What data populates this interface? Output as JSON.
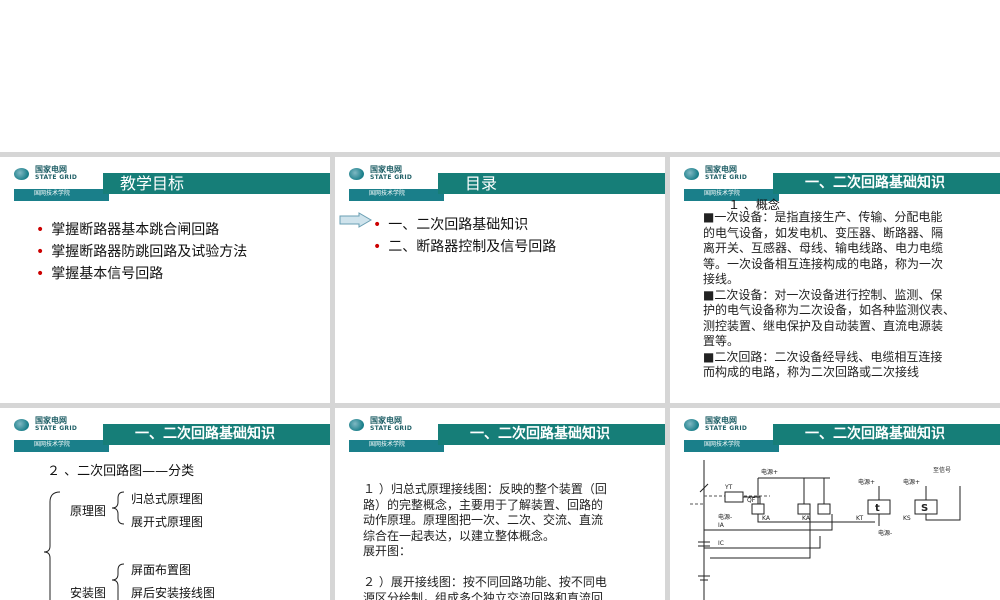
{
  "logo": {
    "cn": "国家电网",
    "en": "STATE GRID",
    "sub": "国网技术学院"
  },
  "slides": {
    "s1": {
      "title": "教学目标",
      "items": [
        "掌握断路器基本跳合闸回路",
        "掌握断路器防跳回路及试验方法",
        "掌握基本信号回路"
      ]
    },
    "s2": {
      "title": "目录",
      "items": [
        "一、二次回路基础知识",
        "二、断路器控制及信号回路"
      ]
    },
    "s3": {
      "title": "一、二次回路基础知识",
      "heading": "１ 、概念",
      "lines": [
        "■一次设备：是指直接生产、传输、分配电能",
        "的电气设备，如发电机、变压器、断路器、隔",
        "离开关、互感器、母线、输电线路、电力电缆",
        "等。一次设备相互连接构成的电路，称为一次",
        "接线。",
        "■二次设备：对一次设备进行控制、监测、保",
        "护的电气设备称为二次设备，如各种监测仪表、",
        "测控装置、继电保护及自动装置、直流电源装",
        "置等。",
        "■二次回路：二次设备经导线、电缆相互连接",
        "而构成的电路，称为二次回路或二次接线"
      ]
    },
    "s4": {
      "title": "一、二次回路基础知识",
      "heading": "２ 、二次回路图——分类",
      "group1": "原理图",
      "group1_items": [
        "归总式原理图",
        "展开式原理图"
      ],
      "group2": "安装图",
      "group2_items": [
        "屏面布置图",
        "屏后安装接线图"
      ]
    },
    "s5": {
      "title": "一、二次回路基础知识",
      "para1": [
        "１ ）归总式原理接线图：反映的整个装置（回",
        "路）的完整概念，主要用于了解装置、回路的",
        "动作原理。原理图把一次、二次、交流、直流",
        "综合在一起表达，以建立整体概念。",
        "展开图："
      ],
      "para2": [
        "２ ）展开接线图：按不同回路功能、按不同电",
        "源区分绘制，组成多个独立交流回路和直流回"
      ]
    },
    "s6": {
      "title": "一、二次回路基础知识",
      "labels": {
        "yt": "YT",
        "qf": "QF",
        "pos1": "电源+",
        "pos2": "电源+",
        "pos3": "电源+",
        "sig": "至信号",
        "neg1": "电源-",
        "neg2": "电源-",
        "ia": "IA",
        "ic": "IC",
        "ka1": "KA",
        "ka2": "KA",
        "kt": "KT",
        "ks": "KS",
        "t": "t",
        "s": "S"
      }
    }
  }
}
